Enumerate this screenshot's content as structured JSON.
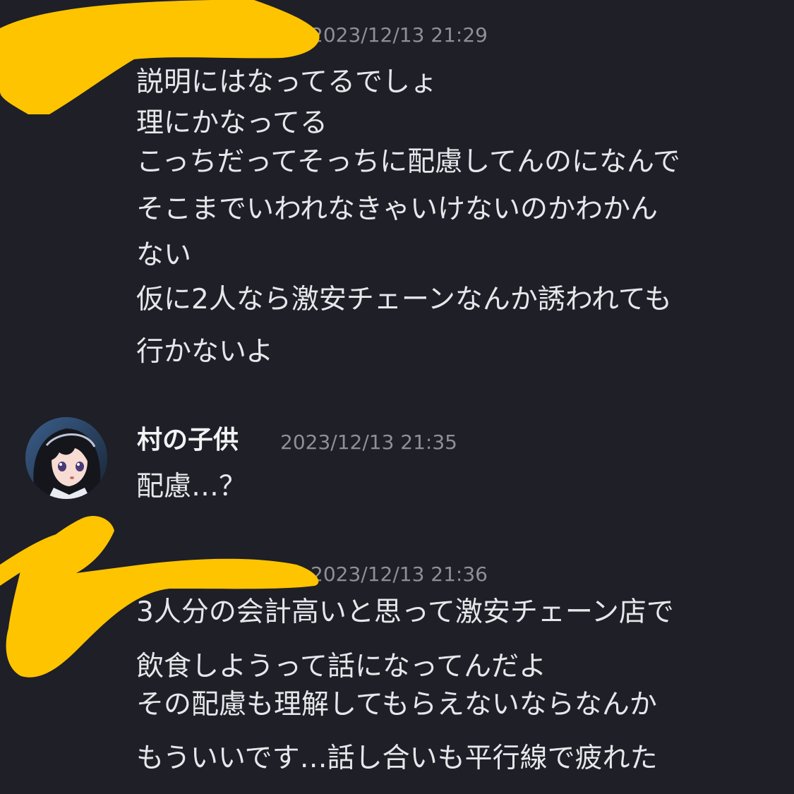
{
  "colors": {
    "background": "#1e1f27",
    "text": "#e6e7ea",
    "username": "#f2f3f5",
    "timestamp": "#8d8f99",
    "redaction": "#ffc400"
  },
  "messages": [
    {
      "author": "",
      "timestamp": "2023/12/13 21:29",
      "lines": [
        "説明にはなってるでしょ",
        "理にかなってる",
        "こっちだってそっちに配慮してんのになんで",
        "そこまでいわれなきゃいけないのかわかん",
        "ない",
        "仮に2人なら激安チェーンなんか誘われても",
        "行かないよ"
      ]
    },
    {
      "author": "村の子供",
      "timestamp": "2023/12/13 21:35",
      "avatar_icon": "anime-girl-avatar-icon",
      "lines": [
        "配慮…？"
      ]
    },
    {
      "author": "",
      "timestamp": "2023/12/13 21:36",
      "lines": [
        "3人分の会計高いと思って激安チェーン店で",
        "飲食しようって話になってんだよ",
        "その配慮も理解してもらえないならなんか",
        "もういいです…話し合いも平行線で疲れた"
      ]
    }
  ]
}
